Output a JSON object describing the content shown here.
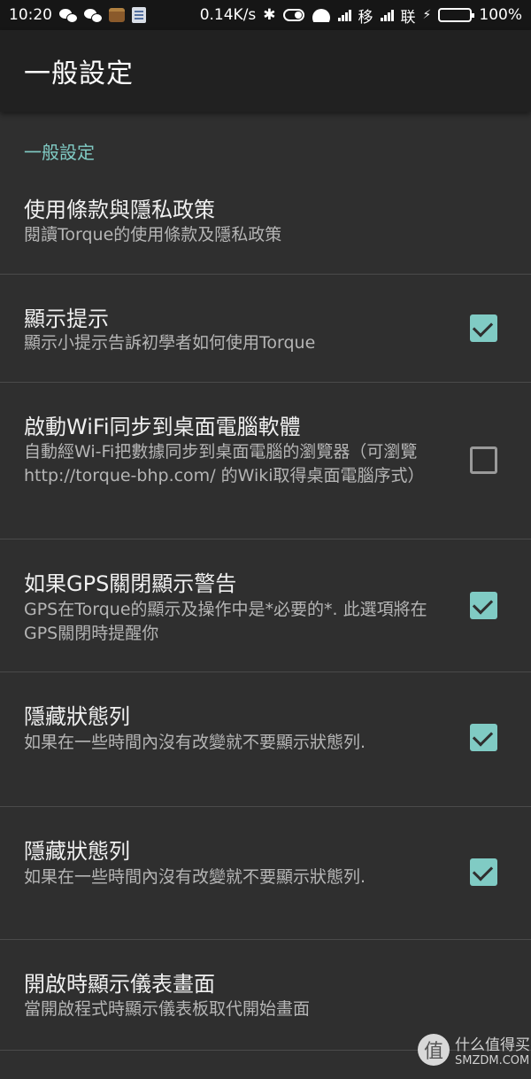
{
  "status_bar": {
    "time": "10:20",
    "speed": "0.14K/s",
    "carrier1": "移",
    "carrier2": "联",
    "battery": "100%",
    "icons": [
      "wechat-icon",
      "wechat-icon",
      "app-icon",
      "app-icon",
      "bluetooth-icon",
      "toggle-icon",
      "wifi-icon",
      "signal-icon",
      "signal-icon",
      "charging-icon",
      "battery-icon"
    ]
  },
  "appbar": {
    "title": "一般設定"
  },
  "category": "一般設定",
  "prefs": [
    {
      "title": "使用條款與隱私政策",
      "summary": "閱讀Torque的使用條款及隱私政策"
    },
    {
      "title": "顯示提示",
      "summary": "顯示小提示告訴初學者如何使用Torque",
      "checked": true
    },
    {
      "title": "啟動WiFi同步到桌面電腦軟體",
      "summary": "自動經Wi-Fi把數據同步到桌面電腦的瀏覽器（可瀏覽http://torque-bhp.com/ 的Wiki取得桌面電腦序式）",
      "checked": false
    },
    {
      "title": "如果GPS關閉顯示警告",
      "summary": "GPS在Torque的顯示及操作中是*必要的*. 此選項將在GPS關閉時提醒你",
      "checked": true
    },
    {
      "title": "隱藏狀態列",
      "summary": "如果在一些時間內沒有改變就不要顯示狀態列.",
      "checked": true
    },
    {
      "title": "隱藏狀態列",
      "summary": "如果在一些時間內沒有改變就不要顯示狀態列.",
      "checked": true
    },
    {
      "title": "開啟時顯示儀表畫面",
      "summary": "當開啟程式時顯示儀表板取代開始畫面"
    }
  ],
  "watermark": {
    "logo": "值",
    "main": "什么值得买",
    "sub": "SMZDM.COM"
  },
  "colors": {
    "accent": "#80cbc4",
    "background": "#2f2f2f",
    "appbar": "#212121",
    "statusbar": "#161616"
  }
}
